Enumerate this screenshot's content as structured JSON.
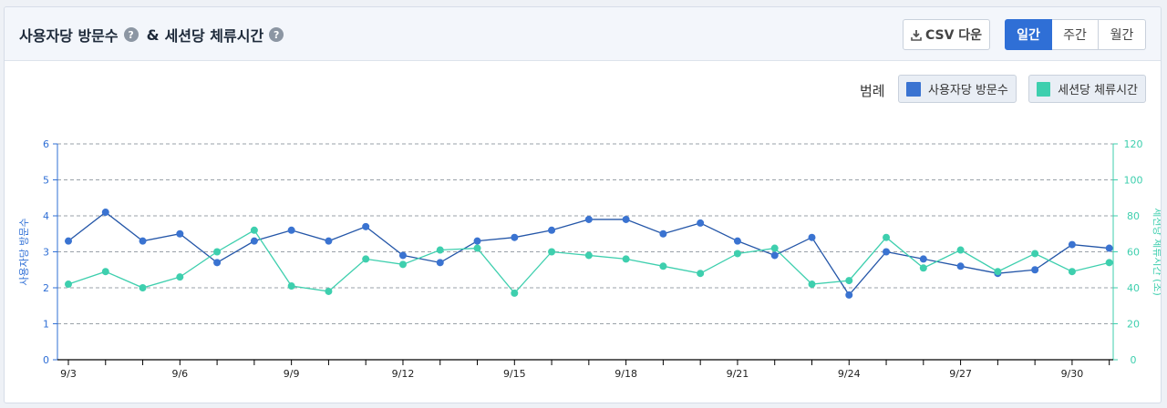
{
  "header": {
    "title_part1": "사용자당 방문수",
    "title_amp": "&",
    "title_part2": "세션당 체류시간",
    "help_glyph": "?",
    "csv_label": "CSV 다운",
    "period_tabs": [
      "일간",
      "주간",
      "월간"
    ],
    "active_period": "일간"
  },
  "legend": {
    "label": "범례",
    "items": [
      {
        "name": "사용자당 방문수",
        "color": "#3a73d1"
      },
      {
        "name": "세션당 체류시간",
        "color": "#3ecfae"
      }
    ]
  },
  "chart_data": {
    "type": "line",
    "categories": [
      "9/3",
      "9/4",
      "9/5",
      "9/6",
      "9/7",
      "9/8",
      "9/9",
      "9/10",
      "9/11",
      "9/12",
      "9/13",
      "9/14",
      "9/15",
      "9/16",
      "9/17",
      "9/18",
      "9/19",
      "9/20",
      "9/21",
      "9/22",
      "9/23",
      "9/24",
      "9/25",
      "9/26",
      "9/27",
      "9/28",
      "9/29",
      "9/30",
      "10/1"
    ],
    "xtick_labels": [
      "9/3",
      "9/6",
      "9/9",
      "9/12",
      "9/15",
      "9/18",
      "9/21",
      "9/24",
      "9/27",
      "9/30"
    ],
    "series": [
      {
        "name": "사용자당 방문수",
        "axis": "left",
        "color": "#3a73d1",
        "line_color": "#2456a8",
        "values": [
          3.3,
          4.1,
          3.3,
          3.5,
          2.7,
          3.3,
          3.6,
          3.3,
          3.7,
          2.9,
          2.7,
          3.3,
          3.4,
          3.6,
          3.9,
          3.9,
          3.5,
          3.8,
          3.3,
          2.9,
          3.4,
          1.8,
          3.0,
          2.8,
          2.6,
          2.4,
          2.5,
          3.2,
          3.1
        ]
      },
      {
        "name": "세션당 체류시간",
        "axis": "right",
        "color": "#3ecfae",
        "line_color": "#3ecfae",
        "values": [
          42,
          49,
          40,
          46,
          60,
          72,
          41,
          38,
          56,
          53,
          61,
          62,
          37,
          60,
          58,
          56,
          52,
          48,
          59,
          62,
          42,
          44,
          68,
          51,
          61,
          49,
          59,
          49,
          54
        ]
      }
    ],
    "ylabel_left": "사용자당 방문수",
    "ylabel_right": "세션당 체류시간 (초)",
    "ylim_left": [
      0,
      6
    ],
    "ylim_right": [
      0,
      120
    ],
    "yticks_left": [
      0,
      1,
      2,
      3,
      4,
      5,
      6
    ],
    "yticks_right": [
      0,
      20,
      40,
      60,
      80,
      100,
      120
    ],
    "grid": true,
    "axis_colors": {
      "left": "#2f6fd6",
      "right": "#3ecfae"
    }
  }
}
